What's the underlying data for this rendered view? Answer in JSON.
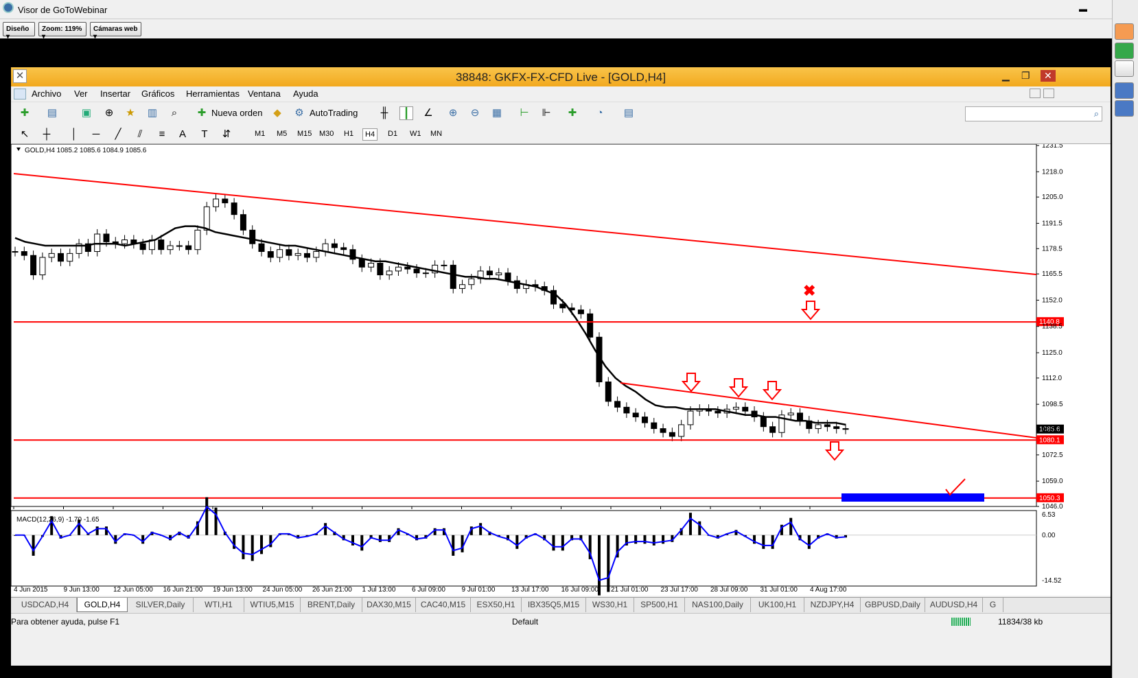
{
  "viewer": {
    "title": "Visor de GoToWebinar",
    "toolbar": [
      "Diseño",
      "Zoom: 119%",
      "Cámaras web"
    ]
  },
  "mt": {
    "title": "38848: GKFX-FX-CFD Live - [GOLD,H4]",
    "menu": [
      "Archivo",
      "Ver",
      "Insertar",
      "Gráficos",
      "Herramientas",
      "Ventana",
      "Ayuda"
    ],
    "new_order": "Nueva orden",
    "autotrading": "AutoTrading",
    "timeframes": [
      "M1",
      "M5",
      "M15",
      "M30",
      "H1",
      "H4",
      "D1",
      "W1",
      "MN"
    ],
    "selected_timeframe": "H4"
  },
  "chart_data": {
    "type": "candlestick",
    "header": "GOLD,H4  1085.2 1085.6 1084.9 1085.6",
    "y_ticks": [
      "1231.5",
      "1218.0",
      "1205.0",
      "1191.5",
      "1178.5",
      "1165.5",
      "1152.0",
      "1138.5",
      "1125.0",
      "1112.0",
      "1098.5",
      "1085.6",
      "1072.5",
      "1059.0",
      "1046.0"
    ],
    "ylim": [
      1046.0,
      1231.5
    ],
    "current_price": "1085.6",
    "hlines": [
      {
        "label": "1140.8",
        "value": 1140.8
      },
      {
        "label": "1080.1",
        "value": 1080.1
      },
      {
        "label": "1050.3",
        "value": 1050.3
      }
    ],
    "x_ticks": [
      "4 Jun 2015",
      "9 Jun 13:00",
      "12 Jun 05:00",
      "16 Jun 21:00",
      "19 Jun 13:00",
      "24 Jun 05:00",
      "26 Jun 21:00",
      "1 Jul 13:00",
      "6 Jul 09:00",
      "9 Jul 01:00",
      "13 Jul 17:00",
      "16 Jul 09:00",
      "21 Jul 01:00",
      "23 Jul 17:00",
      "28 Jul 09:00",
      "31 Jul 01:00",
      "4 Aug 17:00"
    ],
    "close_path": [
      1177,
      1175,
      1165,
      1174,
      1176,
      1172,
      1176,
      1181,
      1177,
      1186,
      1182,
      1181,
      1183,
      1181,
      1178,
      1183,
      1178,
      1180,
      1180,
      1178,
      1188,
      1200,
      1204,
      1202,
      1196,
      1188,
      1181,
      1177,
      1174,
      1178,
      1175,
      1176,
      1174,
      1177,
      1181,
      1179,
      1178,
      1173,
      1169,
      1171,
      1165,
      1167,
      1169,
      1168,
      1166,
      1166,
      1170,
      1170,
      1158,
      1160,
      1163,
      1167,
      1165,
      1166,
      1162,
      1158,
      1160,
      1159,
      1157,
      1150,
      1148,
      1147,
      1145,
      1133,
      1110,
      1100,
      1097,
      1094,
      1092,
      1089,
      1086,
      1084,
      1082,
      1088,
      1095,
      1096,
      1095,
      1094,
      1096,
      1097,
      1095,
      1092,
      1087,
      1084,
      1093,
      1094,
      1090,
      1086,
      1088,
      1087,
      1086,
      1085.6
    ],
    "ma_path": [
      1184,
      1182,
      1181,
      1180,
      1180,
      1180,
      1180,
      1180,
      1181,
      1181,
      1181,
      1180,
      1181,
      1182,
      1183,
      1186,
      1189,
      1190,
      1190,
      1189,
      1187,
      1186,
      1185,
      1184,
      1183,
      1182,
      1181,
      1180,
      1180,
      1179,
      1178,
      1177,
      1176,
      1175,
      1174,
      1173,
      1172,
      1172,
      1171,
      1170,
      1169,
      1168,
      1167,
      1166,
      1165,
      1164,
      1164,
      1163,
      1163,
      1162,
      1161,
      1160,
      1159,
      1157,
      1155,
      1150,
      1143,
      1135,
      1126,
      1118,
      1112,
      1108,
      1105,
      1101,
      1098,
      1097,
      1097,
      1096,
      1096,
      1096,
      1096,
      1095,
      1094,
      1093,
      1093,
      1092,
      1092,
      1091,
      1090,
      1090,
      1089,
      1089,
      1089,
      1088
    ],
    "macd": {
      "label": "MACD(12,26,9) -1.70 -1.65",
      "y_ticks": [
        "6.53",
        "0.00",
        "-14.52"
      ],
      "ylim": [
        -14.52,
        6.53
      ]
    },
    "symbols_active": "GOLD,H4"
  },
  "tabs": [
    "USDCAD,H4",
    "GOLD,H4",
    "SILVER,Daily",
    "WTI,H1",
    "WTIU5,M15",
    "BRENT,Daily",
    "DAX30,M15",
    "CAC40,M15",
    "ESX50,H1",
    "IBX35Q5,M15",
    "WS30,H1",
    "SP500,H1",
    "NAS100,Daily",
    "UK100,H1",
    "NZDJPY,H4",
    "GBPUSD,Daily",
    "AUDUSD,H4",
    "G"
  ],
  "selected_tab": "GOLD,H4",
  "status": {
    "help": "Para obtener ayuda, pulse F1",
    "profile": "Default",
    "traffic": "11834/38 kb"
  },
  "colors": {
    "accent": "#f2a91e",
    "red": "#ff0000",
    "blue": "#0000ff"
  }
}
